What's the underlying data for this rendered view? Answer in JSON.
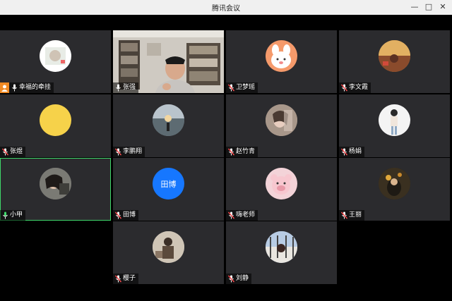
{
  "window": {
    "title": "腾讯会议"
  },
  "participants": [
    {
      "name": "幸福的牵挂",
      "host": true,
      "muted": false
    },
    {
      "name": "张强",
      "video": true,
      "muted": false
    },
    {
      "name": "卫梦瑶",
      "muted": true
    },
    {
      "name": "李文霞",
      "muted": true
    },
    {
      "name": "张煜",
      "muted": true
    },
    {
      "name": "李鹏翔",
      "muted": true
    },
    {
      "name": "赵竹青",
      "muted": true
    },
    {
      "name": "杨娟",
      "muted": true
    },
    {
      "name": "小甲",
      "muted": false,
      "speaking": true
    },
    {
      "name": "田博",
      "muted": true,
      "avatar_text": "田博"
    },
    {
      "name": "嗨老师",
      "muted": true
    },
    {
      "name": "王丽",
      "muted": true
    },
    {
      "name": "樱子",
      "muted": true
    },
    {
      "name": "刘静",
      "muted": true
    }
  ],
  "colors": {
    "tile_bg": "#2b2b2e",
    "speaking_border": "#3fd76a",
    "host_badge": "#f08a24",
    "muted_mic": "#ff4d4f",
    "avatar_blue": "#1677ff",
    "avatar_yellow": "#f6d24a"
  },
  "icons": {
    "minimize": "minimize-icon",
    "maximize": "maximize-icon",
    "close": "close-icon",
    "mic": "mic-icon",
    "mic_muted": "mic-muted-icon",
    "host": "host-icon"
  }
}
